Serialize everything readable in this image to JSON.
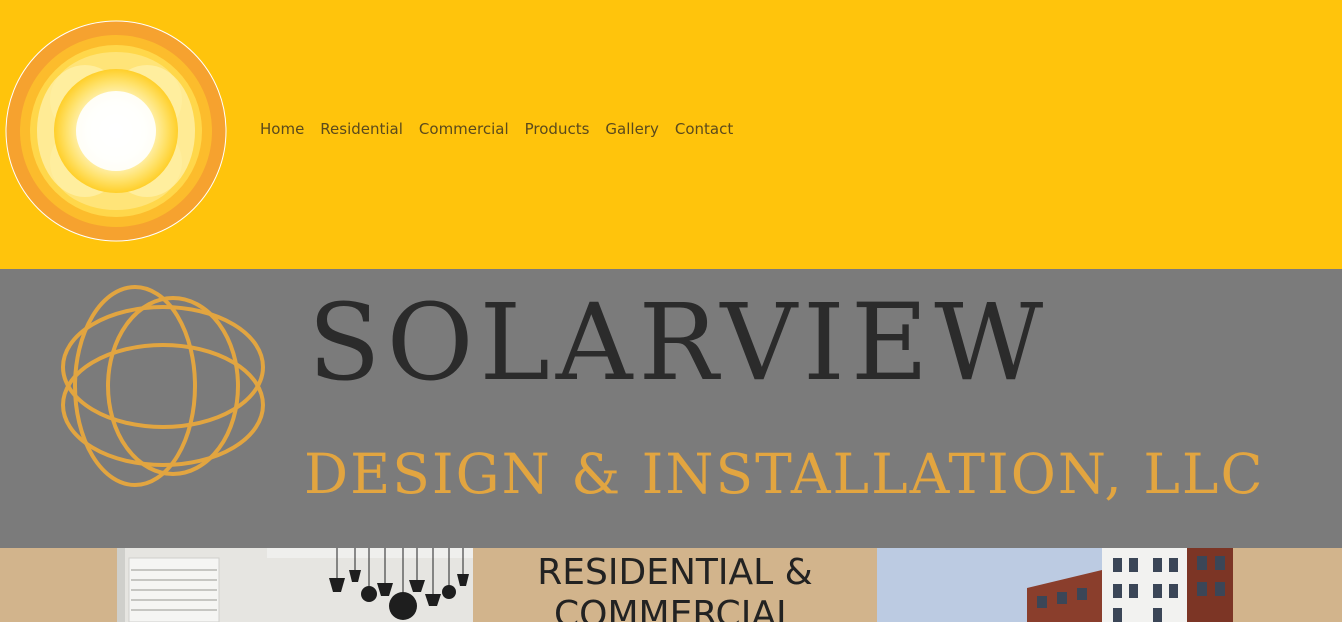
{
  "nav": {
    "items": [
      "Home",
      "Residential",
      "Commercial",
      "Products",
      "Gallery",
      "Contact"
    ]
  },
  "brand": {
    "name": "SOLARVIEW",
    "subtitle": "DESIGN & INSTALLATION, LLC"
  },
  "content": {
    "headline": "RESIDENTIAL & COMMERCIAL"
  },
  "colors": {
    "header_bg": "#ffc40c",
    "banner_bg": "#7b7b7b",
    "content_bg": "#d2b48c",
    "brand_text": "#2b2b2b",
    "brand_accent": "#e2a540"
  },
  "icons": {
    "header_logo": "sun-logo-icon",
    "banner_logo": "interlocking-rings-logo-icon"
  }
}
